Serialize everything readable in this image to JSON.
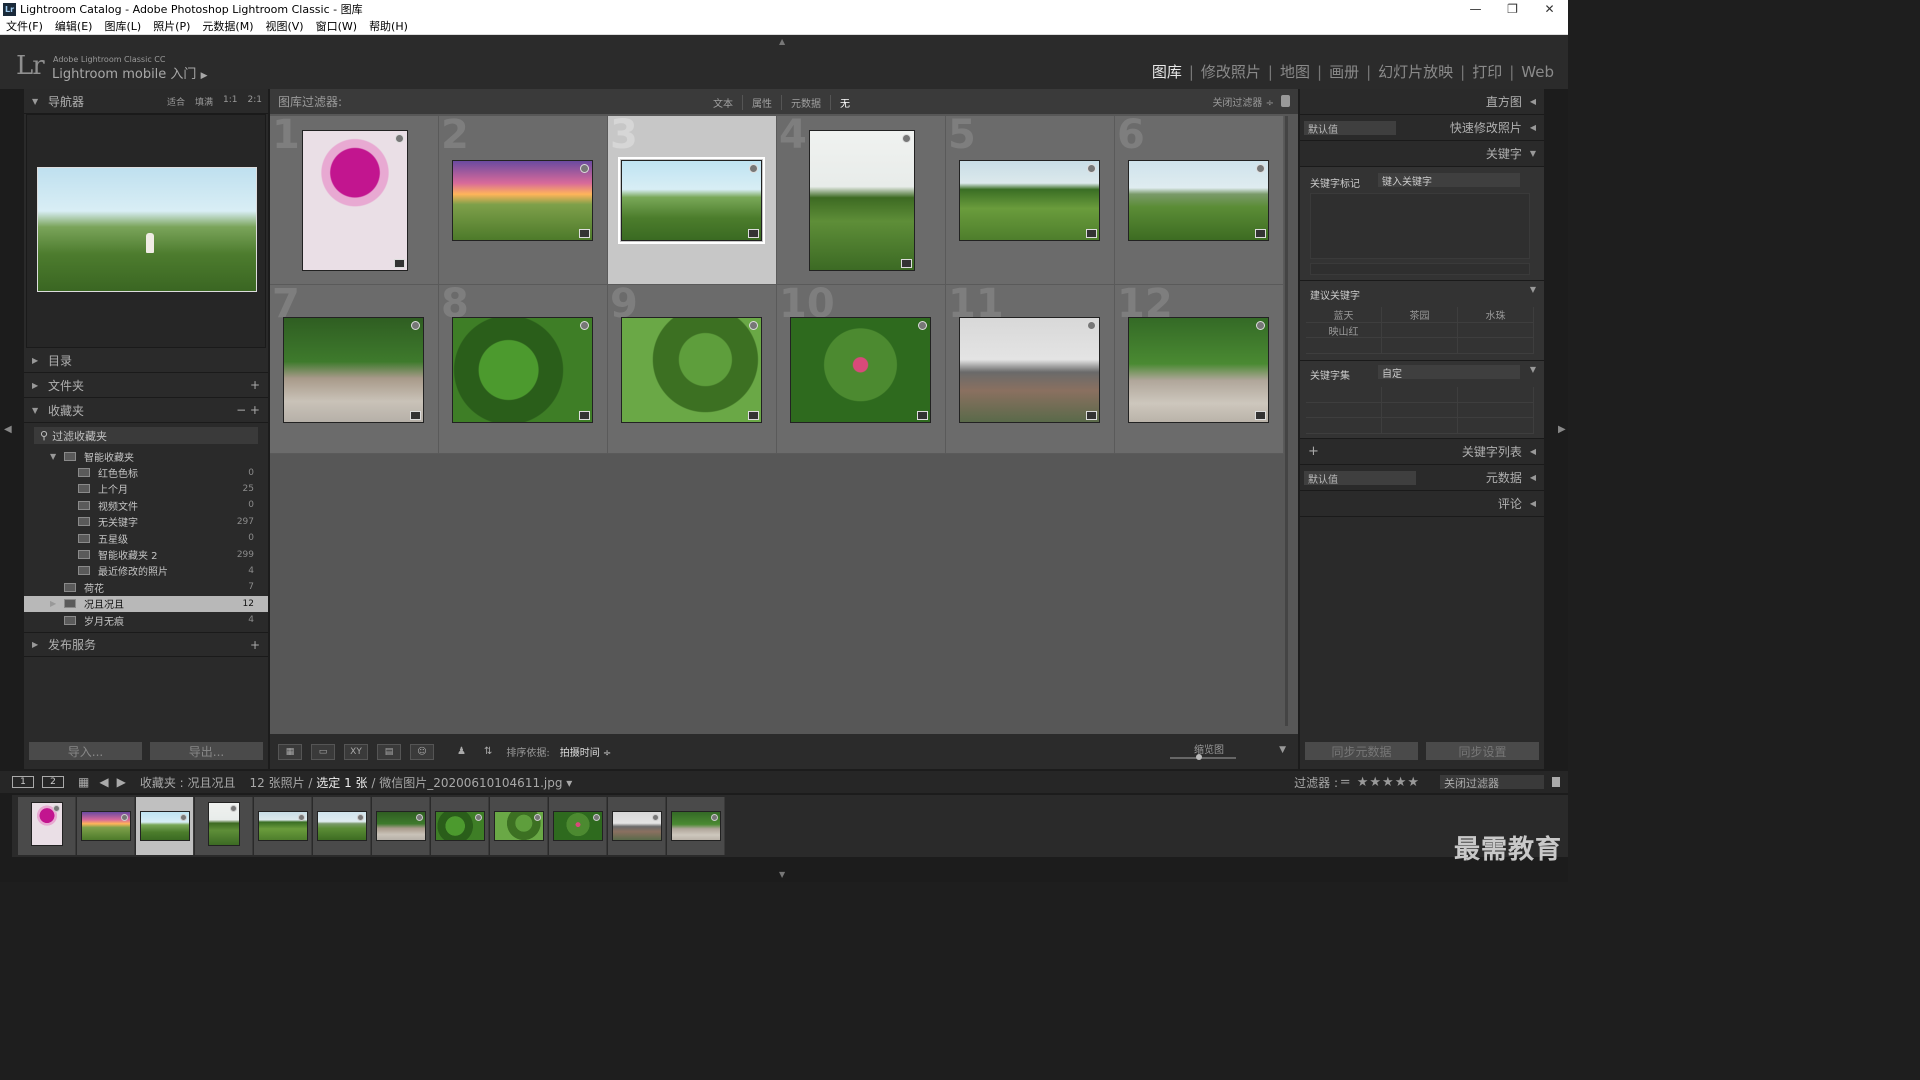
{
  "window": {
    "title": "Lightroom Catalog - Adobe Photoshop Lightroom Classic - 图库",
    "app_icon": "Lr",
    "controls": [
      "—",
      "❐",
      "✕"
    ]
  },
  "menubar": [
    "文件(F)",
    "编辑(E)",
    "图库(L)",
    "照片(P)",
    "元数据(M)",
    "视图(V)",
    "窗口(W)",
    "帮助(H)"
  ],
  "identity": {
    "logo": "Lr",
    "product_line1": "Adobe Lightroom Classic CC",
    "product_line2": "Lightroom mobile 入门",
    "product_arrow": "▶"
  },
  "modules": [
    {
      "label": "图库",
      "active": true
    },
    {
      "label": "修改照片",
      "active": false
    },
    {
      "label": "地图",
      "active": false
    },
    {
      "label": "画册",
      "active": false
    },
    {
      "label": "幻灯片放映",
      "active": false
    },
    {
      "label": "打印",
      "active": false
    },
    {
      "label": "Web",
      "active": false
    }
  ],
  "left_panel": {
    "navigator": {
      "label": "导航器",
      "opts": [
        "适合",
        "填满",
        "1:1",
        "2:1"
      ]
    },
    "catalog": {
      "label": "目录"
    },
    "folders": {
      "label": "文件夹",
      "action": "+"
    },
    "collections": {
      "label": "收藏夹",
      "actions": "− +",
      "filter_placeholder": "过滤收藏夹",
      "items": [
        {
          "label": "智能收藏夹",
          "count": "",
          "indent": 1,
          "tri": "▼"
        },
        {
          "label": "红色色标",
          "count": "0",
          "indent": 2
        },
        {
          "label": "上个月",
          "count": "25",
          "indent": 2
        },
        {
          "label": "视频文件",
          "count": "0",
          "indent": 2
        },
        {
          "label": "无关键字",
          "count": "297",
          "indent": 2
        },
        {
          "label": "五星级",
          "count": "0",
          "indent": 2
        },
        {
          "label": "智能收藏夹 2",
          "count": "299",
          "indent": 2
        },
        {
          "label": "最近修改的照片",
          "count": "4",
          "indent": 2
        },
        {
          "label": "荷花",
          "count": "7",
          "indent": 1
        },
        {
          "label": "况且况且",
          "count": "12",
          "indent": 1,
          "selected": true,
          "tri": "▶"
        },
        {
          "label": "岁月无痕",
          "count": "4",
          "indent": 1
        }
      ]
    },
    "publish": {
      "label": "发布服务",
      "action": "+"
    },
    "import_btn": "导入...",
    "export_btn": "导出..."
  },
  "filter_bar": {
    "label": "图库过滤器:",
    "options": [
      "文本",
      "属性",
      "元数据",
      "无"
    ],
    "off_label": "关闭过滤器 ÷"
  },
  "grid": [
    {
      "num": "1",
      "shape": "p",
      "img": "flower",
      "selected": false
    },
    {
      "num": "2",
      "shape": "l",
      "img": "sunset",
      "selected": false
    },
    {
      "num": "3",
      "shape": "l",
      "img": "tea",
      "selected": true
    },
    {
      "num": "4",
      "shape": "p",
      "img": "tree",
      "selected": false
    },
    {
      "num": "5",
      "shape": "l",
      "img": "hills",
      "selected": false
    },
    {
      "num": "6",
      "shape": "l",
      "img": "house",
      "selected": false
    },
    {
      "num": "7",
      "shape": "w",
      "img": "wall",
      "selected": false
    },
    {
      "num": "8",
      "shape": "w",
      "img": "leaf",
      "selected": false
    },
    {
      "num": "9",
      "shape": "w",
      "img": "leaf2",
      "selected": false
    },
    {
      "num": "10",
      "shape": "w",
      "img": "leaf3",
      "selected": false
    },
    {
      "num": "11",
      "shape": "w",
      "img": "building",
      "selected": false
    },
    {
      "num": "12",
      "shape": "w",
      "img": "wall2",
      "selected": false
    }
  ],
  "toolbar": {
    "view_buttons": [
      "▦",
      "▭",
      "XY",
      "▤",
      "☺"
    ],
    "painter": "♟",
    "sort_label": "排序依据:",
    "sort_value": "拍摄时间 ÷",
    "zoom_label": "缩览图",
    "arrow": "▼"
  },
  "right_panel": {
    "histogram": {
      "label": "直方图"
    },
    "quick_develop": {
      "label": "快速修改照片",
      "preset": "默认值"
    },
    "keywords": {
      "label": "关键字",
      "tags_label": "关键字标记",
      "tags_input": "键入关键字",
      "suggested_label": "建议关键字",
      "suggested": [
        "蓝天",
        "茶园",
        "水珠",
        "映山红",
        "",
        "",
        "",
        "",
        ""
      ],
      "set_label": "关键字集",
      "set_value": "自定"
    },
    "keyword_list": {
      "label": "关键字列表",
      "action": "+"
    },
    "metadata": {
      "label": "元数据",
      "preset": "默认值"
    },
    "comments": {
      "label": "评论"
    },
    "sync_meta_btn": "同步元数据",
    "sync_settings_btn": "同步设置"
  },
  "filmstrip_bar": {
    "mon1": "1",
    "mon2": "2",
    "path": "收藏夹 : 况且况且",
    "count_prefix": "12 张照片 / ",
    "count_selected": "选定 1 张",
    "count_suffix": " / 微信图片_20200610104611.jpg ▾",
    "filter_label": "过滤器 :",
    "stars": "= ★★★★★",
    "filter_value": "关闭过滤器"
  },
  "filmstrip": [
    "flower",
    "sunset",
    "tea",
    "tree",
    "hills",
    "house",
    "wall",
    "leaf",
    "leaf2",
    "leaf3",
    "building",
    "wall2"
  ],
  "watermark": "最需教育"
}
